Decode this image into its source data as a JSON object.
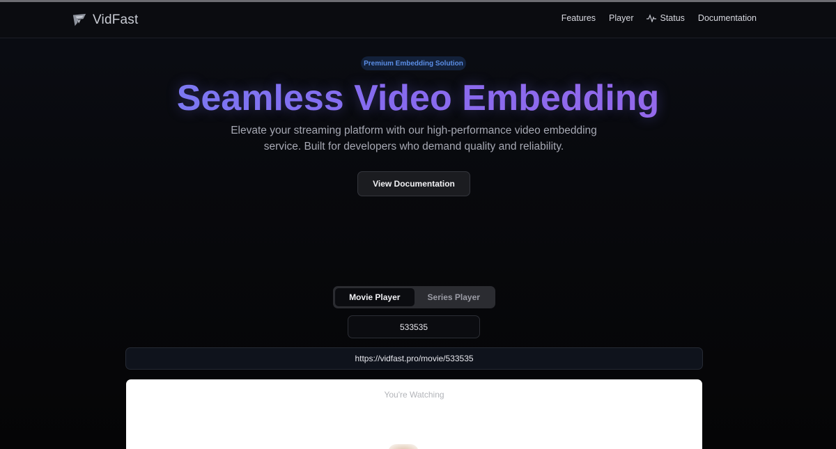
{
  "brand": {
    "name": "VidFast",
    "logo_icon": "vidfast-logo-icon"
  },
  "nav": {
    "links": [
      {
        "label": "Features"
      },
      {
        "label": "Player"
      },
      {
        "label": "Status",
        "icon": "activity-pulse-icon"
      },
      {
        "label": "Documentation"
      }
    ]
  },
  "hero": {
    "badge": "Premium Embedding Solution",
    "title": "Seamless Video Embedding",
    "subtitle": "Elevate your streaming platform with our high-performance video embedding service. Built for developers who demand quality and reliability.",
    "cta_label": "View Documentation"
  },
  "player": {
    "tabs": [
      {
        "label": "Movie Player",
        "active": true
      },
      {
        "label": "Series Player",
        "active": false
      }
    ],
    "id_value": "533535",
    "embed_url": "https://vidfast.pro/movie/533535",
    "watching_label": "You're Watching"
  },
  "colors": {
    "accent_start": "#7388f5",
    "accent_end": "#a368e8",
    "badge_text": "#5b8ee6",
    "background": "#050506"
  }
}
